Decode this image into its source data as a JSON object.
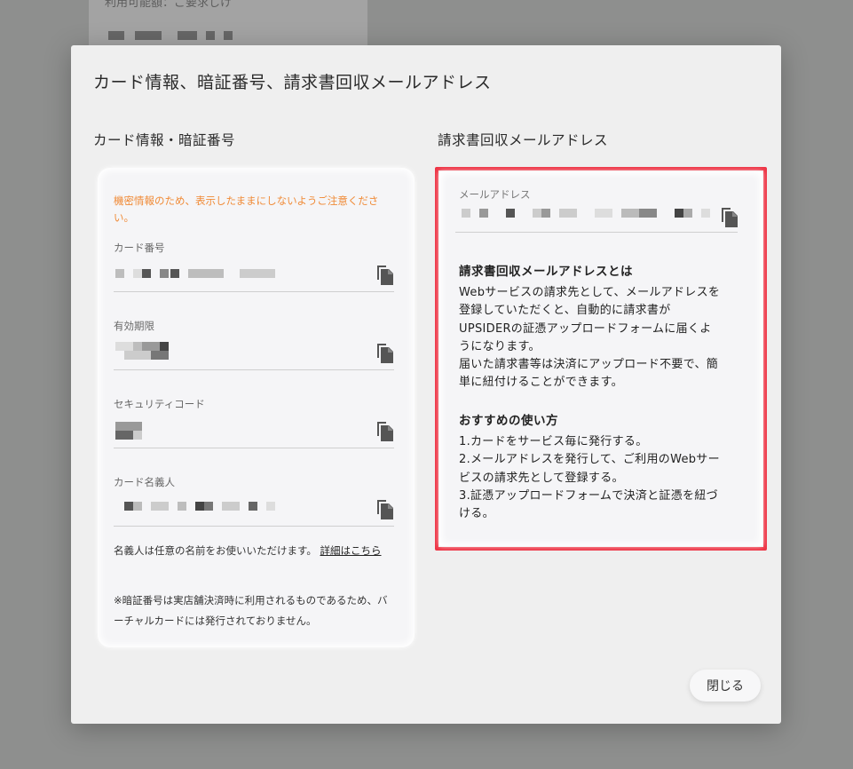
{
  "background": {
    "partial_text": "利用可能額：ご要求しけ"
  },
  "modal": {
    "title": "カード情報、暗証番号、請求書回収メールアドレス",
    "close_label": "閉じる"
  },
  "card_section": {
    "title": "カード情報・暗証番号",
    "warning": "機密情報のため、表示したままにしないようご注意ください。",
    "fields": [
      {
        "label": "カード番号",
        "value": "●●●● ●●●● ●●●● ●●●●",
        "icon": "copy-icon"
      },
      {
        "label": "有効期限",
        "value": "●●/●●",
        "icon": "copy-icon"
      },
      {
        "label": "セキュリティコード",
        "value": "●●●",
        "icon": "copy-icon"
      },
      {
        "label": "カード名義人",
        "value": "●●●●●●●●●●",
        "icon": "copy-icon"
      }
    ],
    "holder_note": "名義人は任意の名前をお使いいただけます。",
    "holder_link": "詳細はこちら",
    "pin_note": "※暗証番号は実店舗決済時に利用されるものであるため、バーチャルカードには発行されておりません。"
  },
  "email_section": {
    "title": "請求書回収メールアドレス",
    "field_label": "メールアドレス",
    "field_value": "●●●●●●●●●●●●●●●●●●●●",
    "about_heading": "請求書回収メールアドレスとは",
    "about_lines": [
      "Webサービスの請求先として、メールアドレスを",
      "登録していただくと、自動的に請求書が",
      "UPSIDERの証憑アップロードフォームに届くよ",
      "うになります。",
      "届いた請求書等は決済にアップロード不要で、簡",
      "単に紐付けることができます。"
    ],
    "usage_heading": "おすすめの使い方",
    "usage_lines": [
      "1.カードをサービス毎に発行する。",
      "2.メールアドレスを発行して、ご利用のWebサー",
      "ビスの請求先として登録する。",
      "3.証憑アップロードフォームで決済と証憑を紐づ",
      "ける。"
    ]
  },
  "colors": {
    "warning": "#f08a36",
    "highlight": "#ee3344",
    "overlay": "#8e8f8e"
  }
}
